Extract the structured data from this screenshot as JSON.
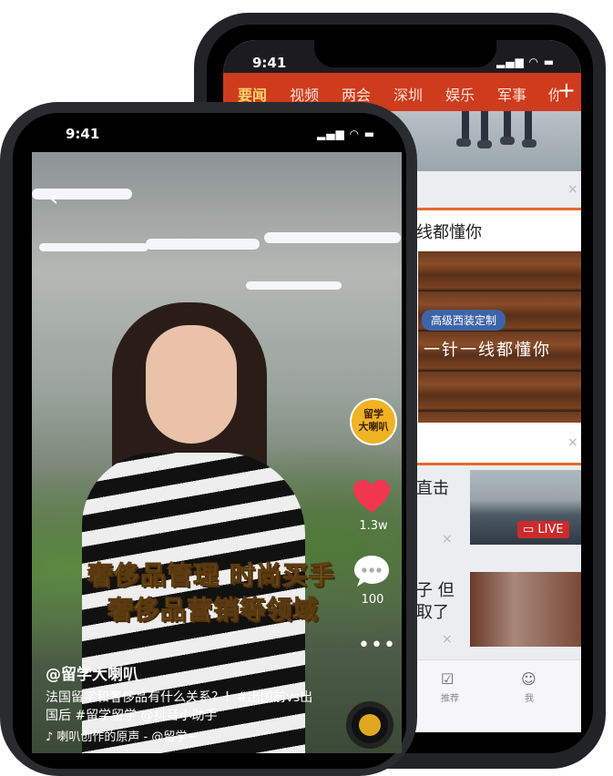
{
  "back_phone": {
    "status_time": "9:41",
    "nav_tabs": [
      "要闻",
      "视频",
      "两会",
      "深圳",
      "娱乐",
      "军事",
      "你"
    ],
    "nav_active_index": 0,
    "nav_plus": "+",
    "close_symbol": "×",
    "headline_partial": "线都懂你",
    "ad_tag": "高级西装定制",
    "ad_slogan": "一针一线都懂你",
    "item1_text": "直击",
    "live_label": "LIVE",
    "item2_text_line1": "子 但",
    "item2_text_line2": "取了",
    "tabbar": [
      "推荐",
      "我"
    ],
    "colors": {
      "nav_bg": "#cf3b1d",
      "nav_active": "#f7d56a",
      "accent_line": "#e66a2c",
      "live": "#cc2b2b"
    }
  },
  "front_phone": {
    "status_time": "9:41",
    "back_symbol": "‹",
    "caption_lines": [
      "奢侈品管理 时尚买手",
      "奢侈品营销等领域"
    ],
    "avatar_text": [
      "留学",
      "大喇叭"
    ],
    "like_count": "1.3w",
    "comment_count": "100",
    "more_symbol": "•••",
    "username": "@留学大喇叭",
    "description": "法国留学和奢侈品有什么关系？！#出国前vs出国后 #留学留学 @抖音小助手",
    "music": "♪ 喇叭创作的原声 - @留学~",
    "colors": {
      "caption": "#f6c84a",
      "like": "#f2364d"
    }
  }
}
